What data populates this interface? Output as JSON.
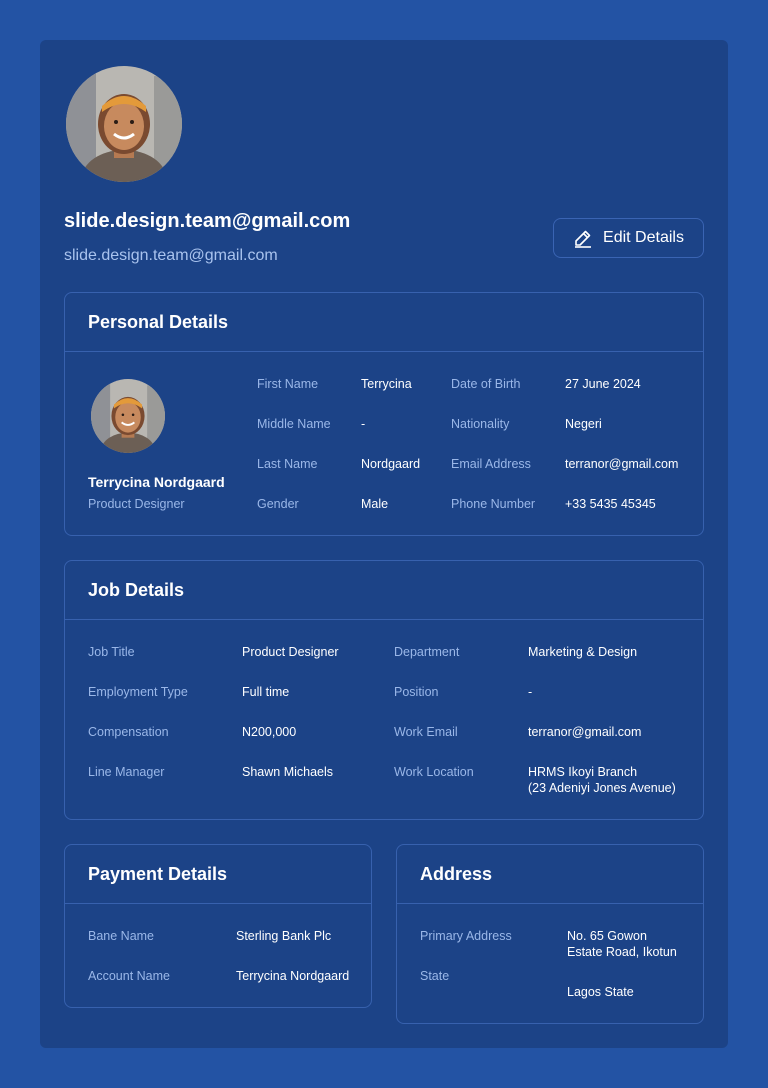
{
  "profile": {
    "email_title": "slide.design.team@gmail.com",
    "email_sub": "slide.design.team@gmail.com",
    "edit_label": "Edit Details"
  },
  "personal": {
    "heading": "Personal Details",
    "name": "Terrycina Nordgaard",
    "role": "Product Designer",
    "fields": [
      {
        "label": "First Name",
        "value": "Terrycina"
      },
      {
        "label": "Middle Name",
        "value": "-"
      },
      {
        "label": "Last Name",
        "value": "Nordgaard"
      },
      {
        "label": "Gender",
        "value": "Male"
      },
      {
        "label": "Date of Birth",
        "value": "27 June 2024"
      },
      {
        "label": "Nationality",
        "value": "Negeri"
      },
      {
        "label": "Email Address",
        "value": "terranor@gmail.com"
      },
      {
        "label": "Phone Number",
        "value": "+33 5435 45345"
      }
    ]
  },
  "job": {
    "heading": "Job Details",
    "fields": [
      {
        "label": "Job Title",
        "value": "Product Designer"
      },
      {
        "label": "Employment Type",
        "value": "Full time"
      },
      {
        "label": "Compensation",
        "value": "N200,000"
      },
      {
        "label": "Line Manager",
        "value": "Shawn Michaels"
      },
      {
        "label": "Department",
        "value": "Marketing & Design"
      },
      {
        "label": "Position",
        "value": "-"
      },
      {
        "label": "Work Email",
        "value": "terranor@gmail.com"
      },
      {
        "label": "Work Location",
        "value": "HRMS Ikoyi Branch",
        "value2": "(23 Adeniyi Jones Avenue)"
      }
    ]
  },
  "payment": {
    "heading": "Payment Details",
    "fields": [
      {
        "label": "Bane Name",
        "value": "Sterling Bank Plc"
      },
      {
        "label": "Account Name",
        "value": "Terrycina Nordgaard"
      }
    ]
  },
  "address": {
    "heading": "Address",
    "fields": [
      {
        "label": "Primary Address",
        "value": "No. 65 Gowon",
        "value2": "Estate Road, Ikotun"
      },
      {
        "label": "State",
        "value": "Lagos State"
      }
    ]
  },
  "colors": {
    "background": "#2353a4",
    "panel": "#1c4387",
    "border": "#3761ae",
    "label": "#9ab7e8"
  }
}
